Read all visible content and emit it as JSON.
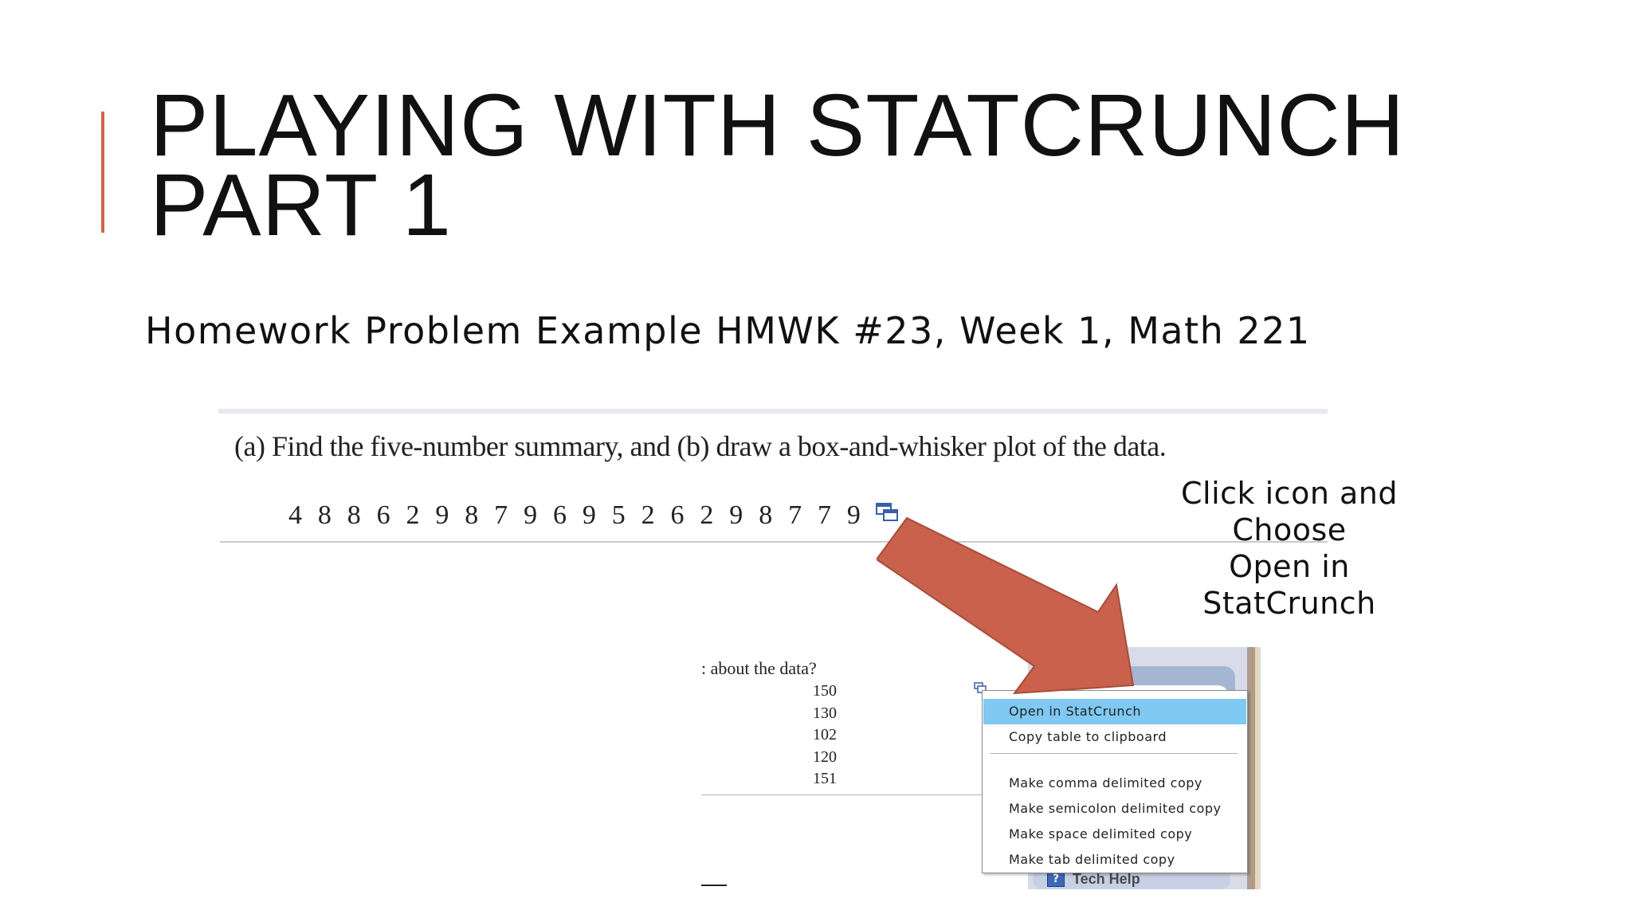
{
  "slide": {
    "title": "PLAYING WITH STATCRUNCH PART 1",
    "subtitle": "Homework Problem Example HMWK #23, Week 1, Math 221",
    "accent_color": "#d1644a"
  },
  "problem": {
    "question": "(a) Find the five-number summary, and (b) draw a box-and-whisker plot of the data.",
    "data": [
      "4",
      "8",
      "8",
      "6",
      "2",
      "9",
      "8",
      "7",
      "9",
      "6",
      "9",
      "5",
      "2",
      "6",
      "2",
      "9",
      "8",
      "7",
      "7",
      "9"
    ],
    "copy_icon": "table-copy-icon"
  },
  "callout": {
    "lines": [
      "Click icon and",
      "Choose",
      "Open in",
      "StatCrunch"
    ],
    "arrow_color": "#c9614d"
  },
  "lower_screenshot": {
    "question_fragment": "about the data?",
    "numbers": [
      "150",
      "130",
      "102",
      "120",
      "151"
    ],
    "tech_help": "Tech Help",
    "tech_help_icon": "?"
  },
  "context_menu": {
    "items": [
      "Open in StatCrunch",
      "Copy table to clipboard",
      "Make comma delimited copy",
      "Make semicolon delimited copy",
      "Make space delimited copy",
      "Make tab delimited copy"
    ],
    "selected_index": 0,
    "highlight_color": "#7fc9f3"
  }
}
